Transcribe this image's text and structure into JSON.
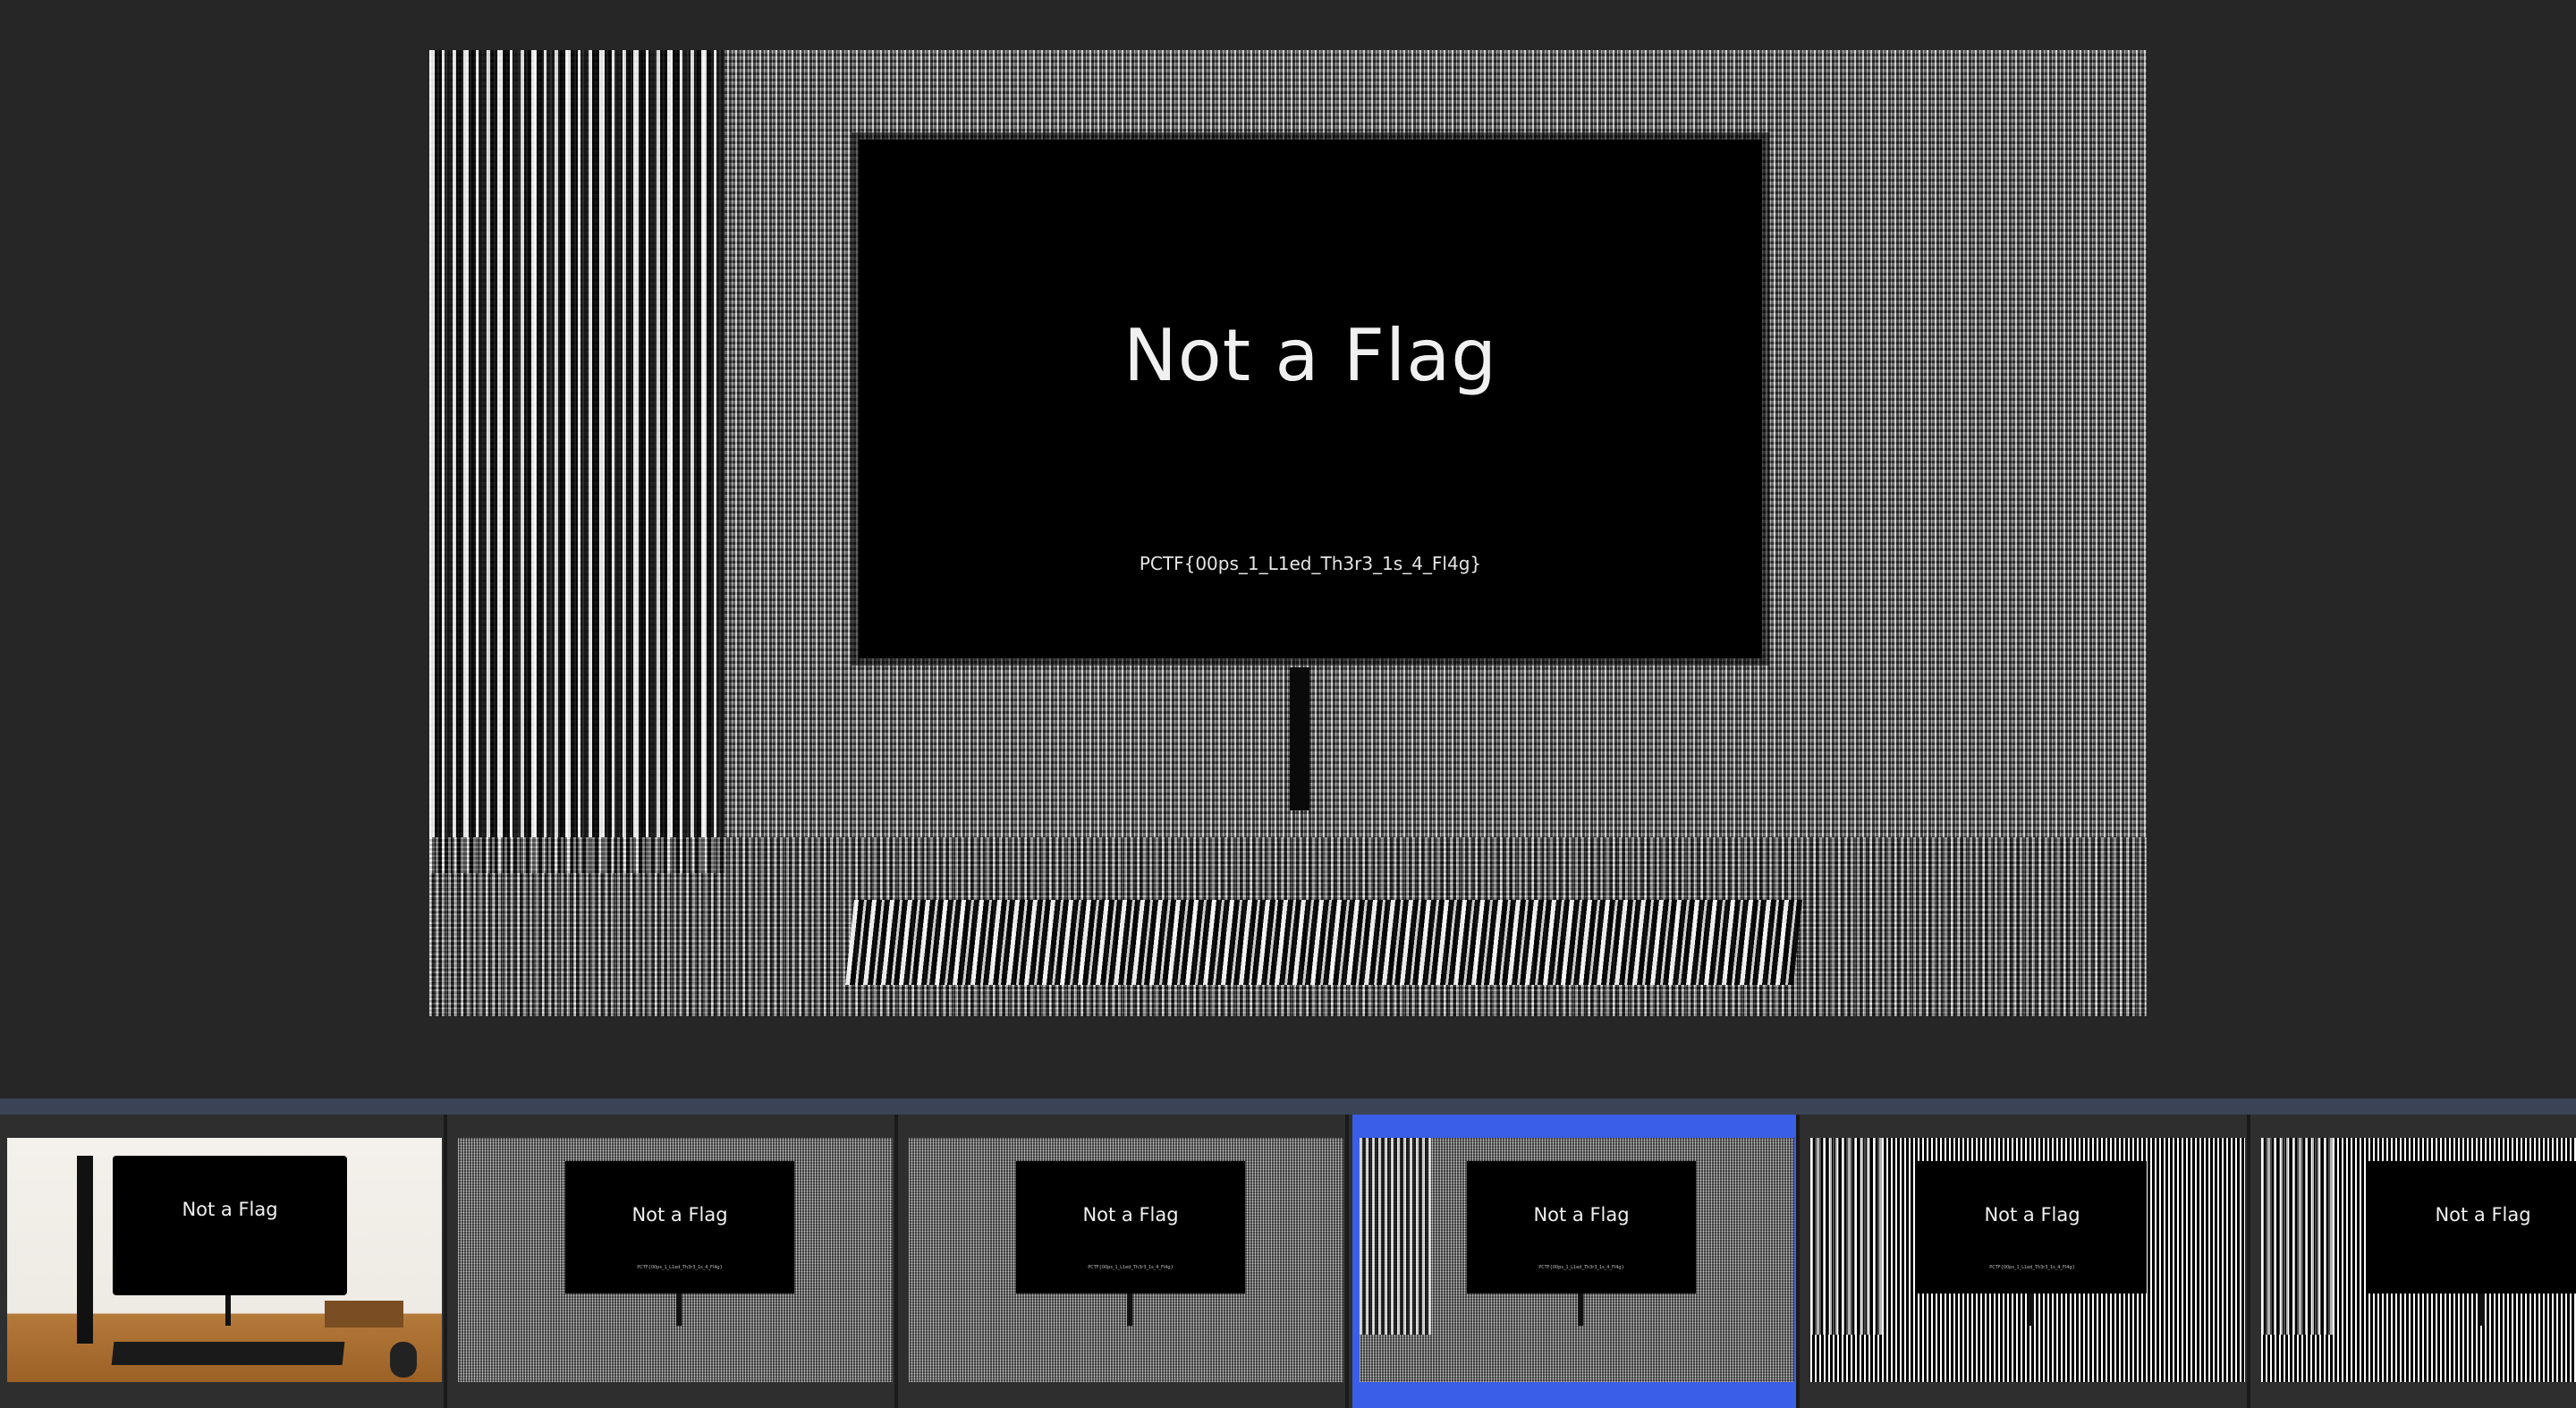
{
  "viewer": {
    "main_image": {
      "screen_title": "Not a Flag",
      "screen_subtext": "PCTF{00ps_1_L1ed_Th3r3_1s_4_Fl4g}"
    }
  },
  "filmstrip": {
    "selected_index": 3,
    "accent_color": "#3a5ee8",
    "thumbnails": [
      {
        "label": "Not a Flag",
        "subtext": ""
      },
      {
        "label": "Not a Flag",
        "subtext": "PCTF{00ps_1_L1ed_Th3r3_1s_4_Fl4g}"
      },
      {
        "label": "Not a Flag",
        "subtext": "PCTF{00ps_1_L1ed_Th3r3_1s_4_Fl4g}"
      },
      {
        "label": "Not a Flag",
        "subtext": "PCTF{00ps_1_L1ed_Th3r3_1s_4_Fl4g}"
      },
      {
        "label": "Not a Flag",
        "subtext": "PCTF{00ps_1_L1ed_Th3r3_1s_4_Fl4g}"
      },
      {
        "label": "Not a Flag",
        "subtext": ""
      }
    ]
  }
}
